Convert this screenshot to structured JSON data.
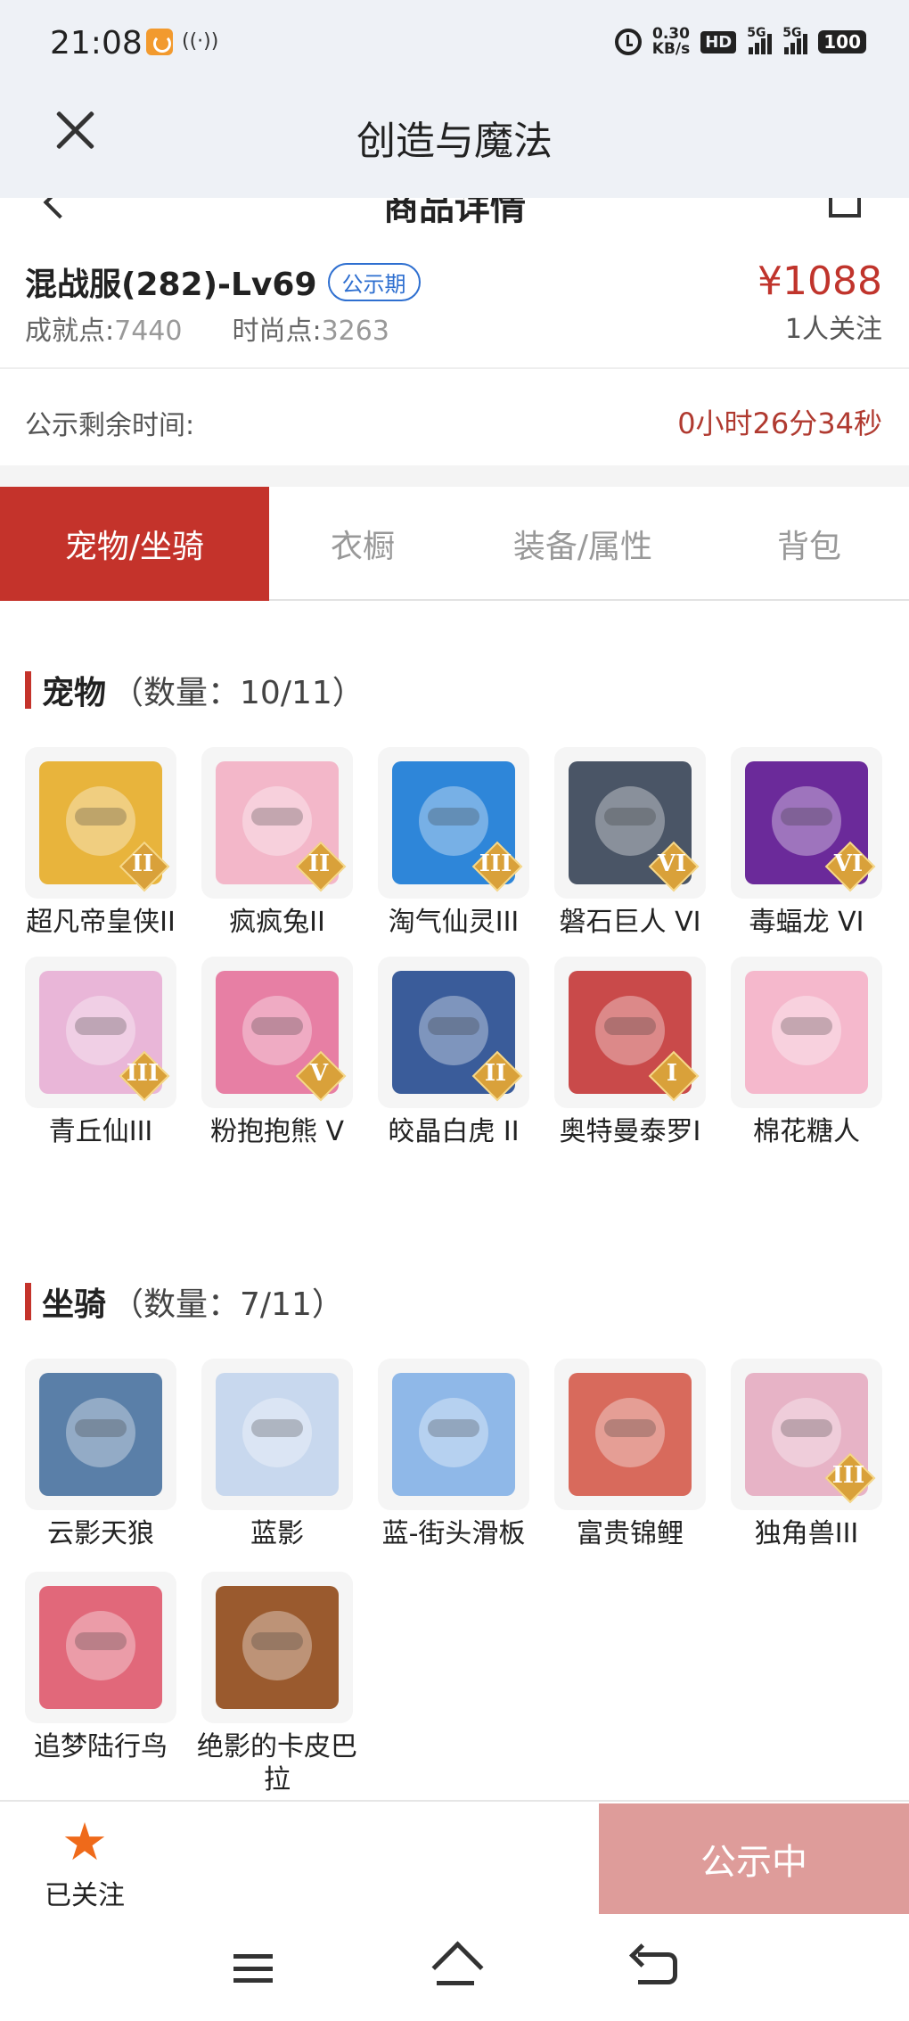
{
  "status_bar": {
    "time": "21:08",
    "nfc": "((·))",
    "net_speed_value": "0.30",
    "net_speed_unit": "KB/s",
    "hd": "HD",
    "network": "5G",
    "battery": "100"
  },
  "app_bar": {
    "title": "创造与魔法"
  },
  "sub_header": {
    "title": "商品详情"
  },
  "product": {
    "name": "混战服(282)-Lv69",
    "badge": "公示期",
    "price": "¥1088",
    "followers": "1人关注",
    "achievement_label": "成就点:",
    "achievement_value": "7440",
    "fashion_label": "时尚点:",
    "fashion_value": "3263"
  },
  "countdown": {
    "label": "公示剩余时间:",
    "value": "0小时26分34秒"
  },
  "tabs": [
    {
      "label": "宠物/坐骑",
      "active": true
    },
    {
      "label": "衣橱",
      "active": false
    },
    {
      "label": "装备/属性",
      "active": false
    },
    {
      "label": "背包",
      "active": false
    }
  ],
  "pets": {
    "title": "宠物",
    "count": "（数量：10/11）",
    "items": [
      {
        "name": "超凡帝皇侠II",
        "tier": "II",
        "color": "#e8b43c"
      },
      {
        "name": "疯疯兔II",
        "tier": "II",
        "color": "#f3b7c9"
      },
      {
        "name": "淘气仙灵III",
        "tier": "III",
        "color": "#2e86d9"
      },
      {
        "name": "磐石巨人 VI",
        "tier": "VI",
        "color": "#4a5566"
      },
      {
        "name": "毒蝠龙 VI",
        "tier": "VI",
        "color": "#6b2a9a"
      },
      {
        "name": "青丘仙III",
        "tier": "III",
        "color": "#e9b6d8"
      },
      {
        "name": "粉抱抱熊 V",
        "tier": "V",
        "color": "#e77fa4"
      },
      {
        "name": "皎晶白虎 II",
        "tier": "II",
        "color": "#3a5c9a"
      },
      {
        "name": "奥特曼泰罗I",
        "tier": "I",
        "color": "#c94a4a"
      },
      {
        "name": "棉花糖人",
        "tier": "",
        "color": "#f5b8cc"
      }
    ]
  },
  "mounts": {
    "title": "坐骑",
    "count": "（数量：7/11）",
    "items": [
      {
        "name": "云影天狼",
        "tier": "",
        "color": "#5a7fa8"
      },
      {
        "name": "蓝影",
        "tier": "",
        "color": "#c8d8ee"
      },
      {
        "name": "蓝-街头滑板",
        "tier": "",
        "color": "#8fb8e8"
      },
      {
        "name": "富贵锦鲤",
        "tier": "",
        "color": "#d86a5c"
      },
      {
        "name": "独角兽III",
        "tier": "III",
        "color": "#e7b3c6"
      },
      {
        "name": "追梦陆行鸟",
        "tier": "",
        "color": "#e1687a"
      },
      {
        "name": "绝影的卡皮巴拉",
        "tier": "",
        "color": "#9a5a2e"
      }
    ]
  },
  "bottom_bar": {
    "follow_label": "已关注",
    "status_label": "公示中"
  },
  "colors": {
    "accent": "#c4332b",
    "star": "#ef6a1a",
    "status_button": "#de9c9a",
    "countdown": "#b03a30",
    "badge": "#2e6fd0"
  }
}
